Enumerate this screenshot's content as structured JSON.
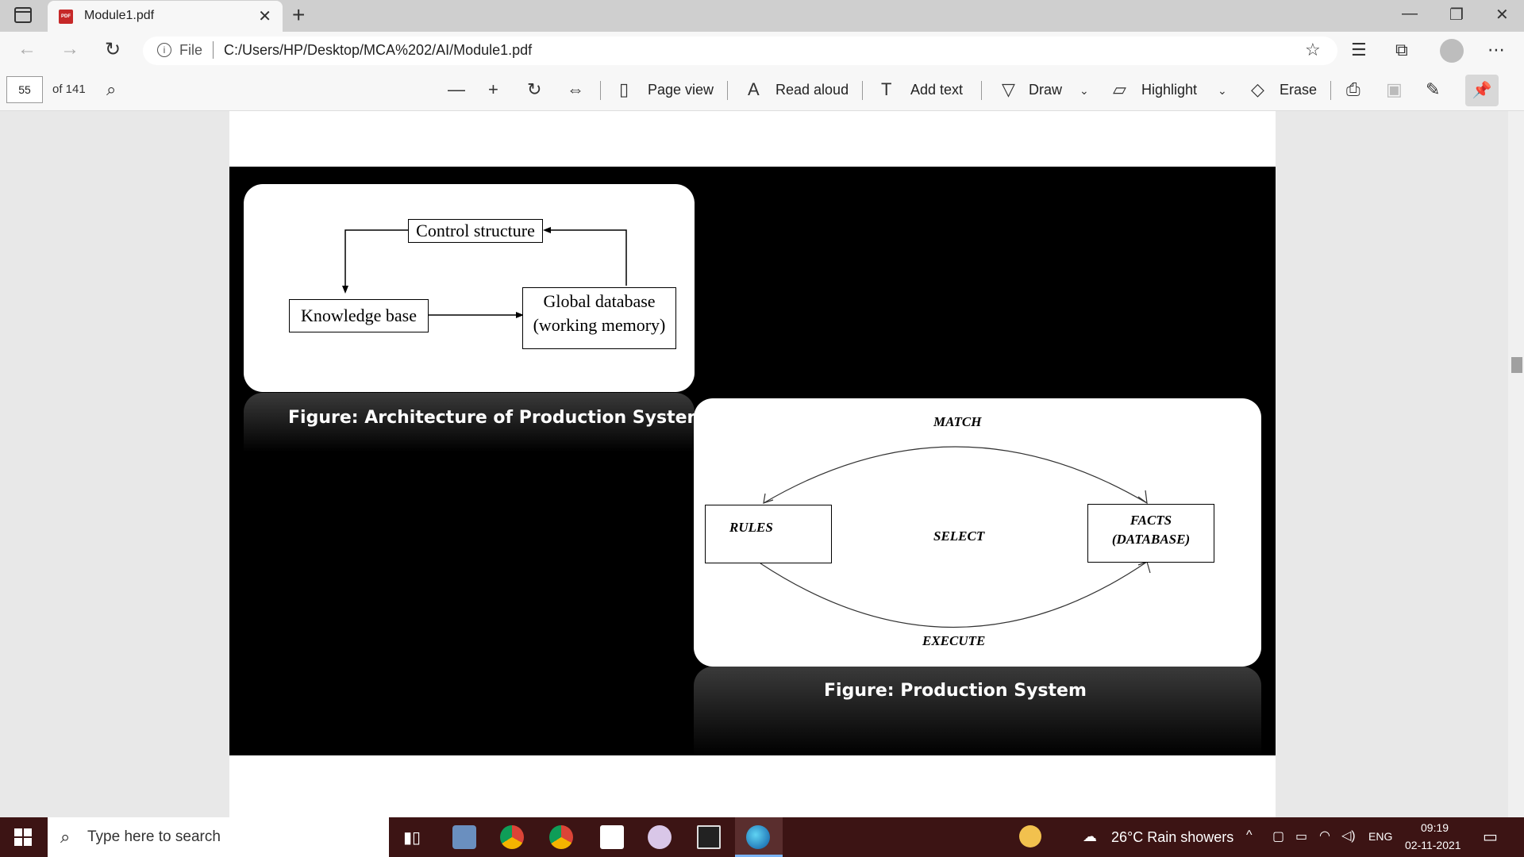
{
  "tab": {
    "title": "Module1.pdf",
    "file_icon_text": "PDF"
  },
  "address": {
    "scheme_label": "File",
    "url": "C:/Users/HP/Desktop/MCA%202/AI/Module1.pdf"
  },
  "pdf_toolbar": {
    "page_number": "55",
    "page_count": "of 141",
    "page_view": "Page view",
    "read_aloud": "Read aloud",
    "add_text": "Add text",
    "draw": "Draw",
    "highlight": "Highlight",
    "erase": "Erase"
  },
  "slide": {
    "fig1": {
      "caption": "Figure:  Architecture of Production System",
      "control": "Control structure",
      "knowledge": "Knowledge base",
      "global_line1": "Global database",
      "global_line2": "(working memory)"
    },
    "fig2": {
      "caption": "Figure:  Production System",
      "match": "MATCH",
      "select": "SELECT",
      "execute": "EXECUTE",
      "rules": "RULES",
      "facts_line1": "FACTS",
      "facts_line2": "(DATABASE)"
    }
  },
  "taskbar": {
    "search_placeholder": "Type here to search",
    "weather": "26°C  Rain showers",
    "lang": "ENG",
    "time": "09:19",
    "date": "02-11-2021"
  }
}
